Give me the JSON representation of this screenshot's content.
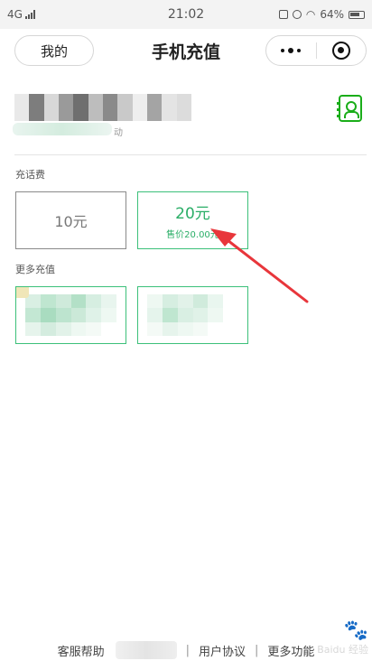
{
  "status_bar": {
    "network": "4G",
    "time": "21:02",
    "battery": "64%"
  },
  "navbar": {
    "back_label": "我的",
    "title": "手机充值"
  },
  "account": {
    "operator_suffix": "动"
  },
  "sections": {
    "phone_fee_label": "充话费",
    "more_label": "更多充值"
  },
  "cards": [
    {
      "amount": "10元"
    },
    {
      "amount": "20元",
      "price": "售价20.00元"
    }
  ],
  "footer": {
    "help": "客服帮助",
    "sep": "|",
    "agreement": "用户协议",
    "more": "更多功能"
  },
  "colors": {
    "accent": "#2aae67",
    "arrow": "#e8363b"
  },
  "watermark": "Baidu 经验"
}
